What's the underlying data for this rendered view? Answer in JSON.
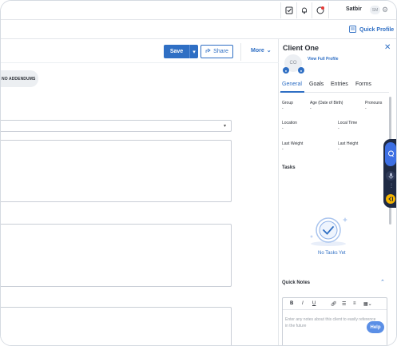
{
  "topbar": {
    "user_name": "Satbir",
    "user_initials": "SM",
    "icons": [
      "checkbox-icon",
      "bell-icon",
      "status-icon",
      "gear-icon"
    ]
  },
  "subbar": {
    "quick_profile_label": "Quick Profile"
  },
  "toolbar": {
    "save_label": "Save",
    "share_label": "Share",
    "more_label": "More"
  },
  "editor": {
    "addendum_label": "NO ADDENDUMS"
  },
  "panel": {
    "client_name": "Client One",
    "client_initials": "CO",
    "view_profile_label": "View Full Profile",
    "tabs": [
      {
        "label": "General"
      },
      {
        "label": "Goals"
      },
      {
        "label": "Entries"
      },
      {
        "label": "Forms"
      }
    ],
    "fields": {
      "group_label": "Group",
      "group_value": "-",
      "age_label": "Age (Date of Birth)",
      "age_value": "-",
      "pronouns_label": "Pronouns",
      "pronouns_value": "-",
      "location_label": "Location",
      "location_value": "-",
      "localtime_label": "Local Time",
      "localtime_value": "-",
      "lastweight_label": "Last Weight",
      "lastweight_value": "-",
      "lastheight_label": "Last Height",
      "lastheight_value": "-"
    },
    "tasks_title": "Tasks",
    "no_tasks_label": "No Tasks Yet",
    "quick_notes_title": "Quick Notes",
    "notes_toolbar": {
      "bold": "B",
      "italic": "I",
      "underline": "U"
    },
    "notes_placeholder": "Enter any notes about this client to easily reference in the future"
  },
  "help_label": "Help",
  "colors": {
    "accent": "#2f6fc4",
    "dock": "#1f2a44",
    "dock_active": "#3d6fe3",
    "dock_exit": "#f4b400"
  }
}
